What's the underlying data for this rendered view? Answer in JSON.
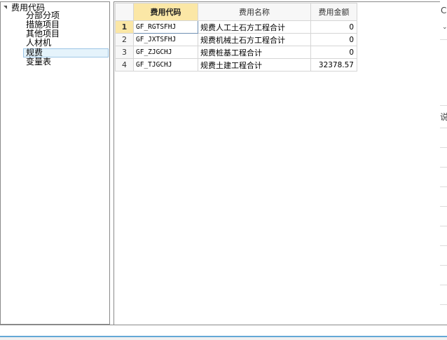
{
  "tree": {
    "root_label": "费用代码",
    "items": [
      {
        "label": "分部分项"
      },
      {
        "label": "措施项目"
      },
      {
        "label": "其他项目"
      },
      {
        "label": "人材机"
      },
      {
        "label": "规费"
      },
      {
        "label": "变量表"
      }
    ],
    "selected_index": 4
  },
  "grid": {
    "columns": [
      "费用代码",
      "费用名称",
      "费用金额"
    ],
    "rows": [
      {
        "num": "1",
        "code": "GF_RGTSFHJ",
        "name": "规费人工土石方工程合计",
        "amount": "0"
      },
      {
        "num": "2",
        "code": "GF_JXTSFHJ",
        "name": "规费机械土石方工程合计",
        "amount": "0"
      },
      {
        "num": "3",
        "code": "GF_ZJGCHJ",
        "name": "规费桩基工程合计",
        "amount": "0"
      },
      {
        "num": "4",
        "code": "GF_TJGCHJ",
        "name": "规费土建工程合计",
        "amount": "32378.57"
      }
    ]
  },
  "right_edge": {
    "top_glyph": "C",
    "mid_glyph": "说"
  }
}
